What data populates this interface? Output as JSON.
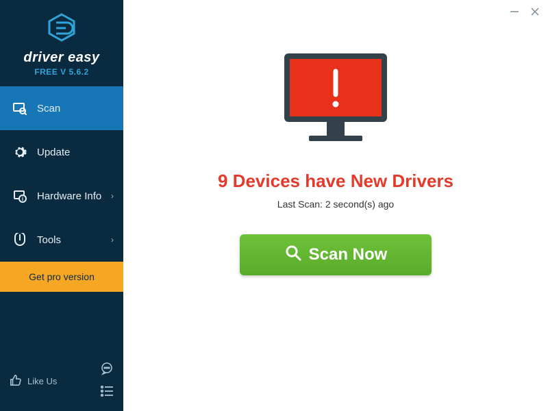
{
  "brand": {
    "name": "driver easy",
    "version_label": "FREE V 5.6.2"
  },
  "sidebar": {
    "items": [
      {
        "label": "Scan",
        "icon": "scan-icon"
      },
      {
        "label": "Update",
        "icon": "gear-icon"
      },
      {
        "label": "Hardware Info",
        "icon": "hardware-icon"
      },
      {
        "label": "Tools",
        "icon": "tools-icon"
      }
    ],
    "pro_label": "Get pro version",
    "like_label": "Like Us"
  },
  "main": {
    "headline": "9 Devices have New Drivers",
    "subline": "Last Scan: 2 second(s) ago",
    "scan_button": "Scan Now"
  },
  "colors": {
    "sidebar_bg": "#0a2a40",
    "active_bg": "#1676b6",
    "accent_orange": "#f5a623",
    "alert_red": "#e53a2b",
    "scan_green": "#6fc23a"
  }
}
